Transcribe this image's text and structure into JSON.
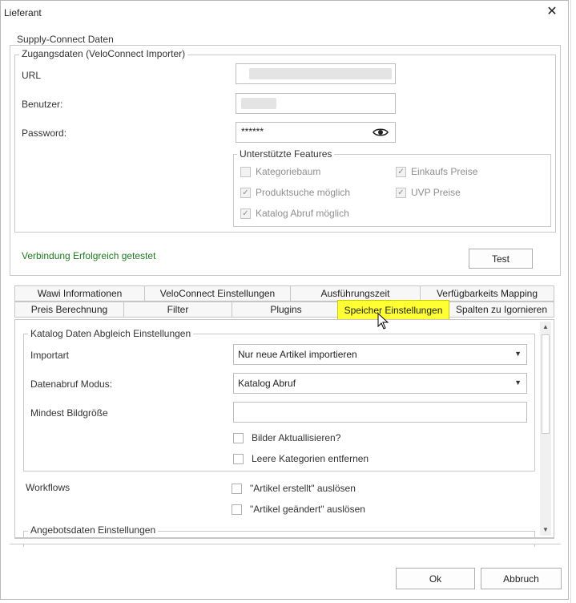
{
  "window": {
    "title": "Lieferant"
  },
  "supply_connect": {
    "legend": "Supply-Connect Daten",
    "access": {
      "legend": "Zugangsdaten (VeloConnect Importer)",
      "url_label": "URL",
      "user_label": "Benutzer:",
      "password_label": "Password:",
      "password_value": "******"
    },
    "features": {
      "legend": "Unterstützte Features",
      "items": [
        {
          "label": "Kategoriebaum",
          "checked": false
        },
        {
          "label": "Einkaufs Preise",
          "checked": true
        },
        {
          "label": "Produktsuche möglich",
          "checked": true
        },
        {
          "label": "UVP Preise",
          "checked": true
        },
        {
          "label": "Katalog Abruf möglich",
          "checked": true
        }
      ]
    },
    "status": "Verbindung Erfolgreich getestet",
    "test_button": "Test"
  },
  "tabs": {
    "row1": [
      "Wawi Informationen",
      "VeloConnect Einstellungen",
      "Ausführungszeit",
      "Verfügbarkeits Mapping"
    ],
    "row2": [
      "Preis Berechnung",
      "Filter",
      "Plugins",
      "Speicher Einstellungen",
      "Spalten zu Igornieren"
    ],
    "active": "Speicher Einstellungen"
  },
  "storage": {
    "catalog": {
      "legend": "Katalog Daten Abgleich Einstellungen",
      "importart_label": "Importart",
      "importart_value": "Nur neue Artikel importieren",
      "mode_label": "Datenabruf Modus:",
      "mode_value": "Katalog Abruf",
      "min_image_label": "Mindest Bildgröße",
      "min_image_value": "",
      "update_images": "Bilder Aktuallisieren?",
      "remove_empty": "Leere Kategorien entfernen"
    },
    "workflows": {
      "label": "Workflows",
      "created": "\"Artikel erstellt\" auslösen",
      "changed": "\"Artikel geändert\" auslösen"
    },
    "offer_legend": "Angebotsdaten Einstellungen"
  },
  "footer": {
    "ok": "Ok",
    "cancel": "Abbruch"
  }
}
